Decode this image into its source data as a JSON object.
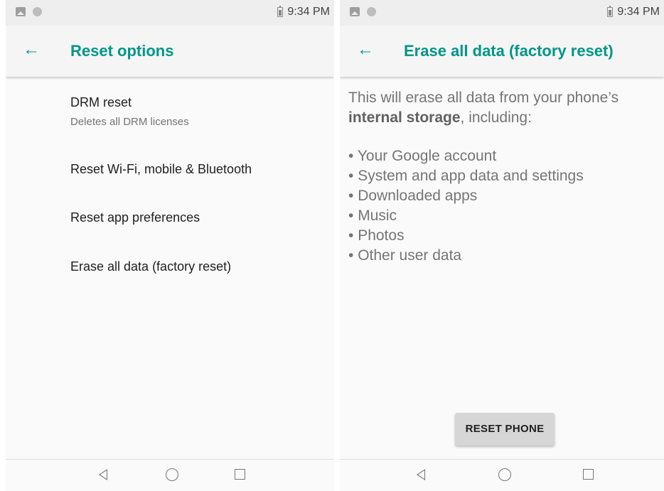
{
  "left": {
    "status_bar": {
      "time": "9:34 PM"
    },
    "app_bar": {
      "title": "Reset options",
      "back_icon": "arrow-left-icon"
    },
    "items": [
      {
        "title": "DRM reset",
        "summary": "Deletes all DRM licenses"
      },
      {
        "title": "Reset Wi-Fi, mobile & Bluetooth"
      },
      {
        "title": "Reset app preferences"
      },
      {
        "title": "Erase all data (factory reset)"
      }
    ]
  },
  "right": {
    "status_bar": {
      "time": "9:34 PM"
    },
    "app_bar": {
      "title": "Erase all data (factory reset)",
      "back_icon": "arrow-left-icon"
    },
    "description_prefix": "This will erase all data from your phone’s",
    "description_bold": "internal storage",
    "description_suffix": ", including:",
    "bullets": [
      "Your Google account",
      "System and app data and settings",
      "Downloaded apps",
      "Music",
      "Photos",
      "Other user data"
    ],
    "reset_button": "RESET PHONE"
  },
  "nav_bar": {
    "icons": [
      "back-triangle-icon",
      "home-circle-icon",
      "recents-square-icon"
    ]
  },
  "colors": {
    "accent": "#009688",
    "background": "#fafafa",
    "status_bar": "#eeeeee",
    "button": "#d6d6d6"
  }
}
